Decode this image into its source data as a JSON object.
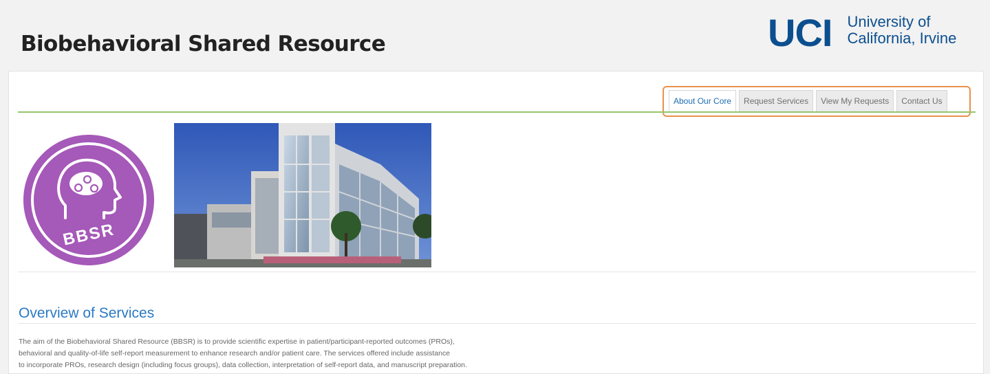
{
  "header": {
    "site_title": "Biobehavioral Shared Resource",
    "logo": {
      "mark": "UCI",
      "line1": "University of",
      "line2": "California, Irvine"
    }
  },
  "nav": {
    "tabs": [
      {
        "label": "About Our Core",
        "active": true
      },
      {
        "label": "Request Services",
        "active": false
      },
      {
        "label": "View My Requests",
        "active": false
      },
      {
        "label": "Contact Us",
        "active": false
      }
    ]
  },
  "bbsr_logo": {
    "text": "BBSR",
    "color": "#a559b8"
  },
  "overview": {
    "title": "Overview of Services",
    "lines": [
      "The aim of the Biobehavioral Shared Resource (BBSR) is to provide scientific expertise in patient/participant-reported outcomes (PROs),",
      "behavioral and quality-of-life self-report measurement to enhance research and/or patient care. The services offered include assistance",
      "to incorporate PROs, research design (including focus groups), data collection, interpretation of self-report data, and manuscript preparation."
    ]
  },
  "colors": {
    "uci_blue": "#0c4f8f",
    "link_blue": "#2a79c4",
    "nav_highlight": "#e8914b",
    "rule_green": "#93c56a"
  }
}
